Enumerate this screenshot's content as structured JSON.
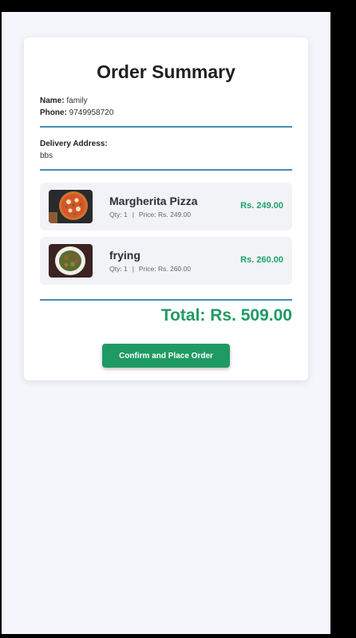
{
  "page": {
    "title": "Order Summary"
  },
  "customer": {
    "name_label": "Name:",
    "name_value": "family",
    "phone_label": "Phone:",
    "phone_value": "9749958720"
  },
  "delivery": {
    "label": "Delivery Address:",
    "value": "bbs"
  },
  "items": [
    {
      "name": "Margherita Pizza",
      "qty": "Qty: 1",
      "separator": "|",
      "price_text": "Price: Rs. 249.00",
      "line_total": "Rs. 249.00",
      "image": "pizza-image"
    },
    {
      "name": "frying",
      "qty": "Qty: 1",
      "separator": "|",
      "price_text": "Price: Rs. 260.00",
      "line_total": "Rs. 260.00",
      "image": "fried-food-bowl-image"
    }
  ],
  "total": "Total: Rs. 509.00",
  "actions": {
    "confirm_label": "Confirm and Place Order"
  },
  "colors": {
    "accent_green": "#1f9a64",
    "divider_blue": "#4a8bb5",
    "background": "#f4f6fb"
  }
}
